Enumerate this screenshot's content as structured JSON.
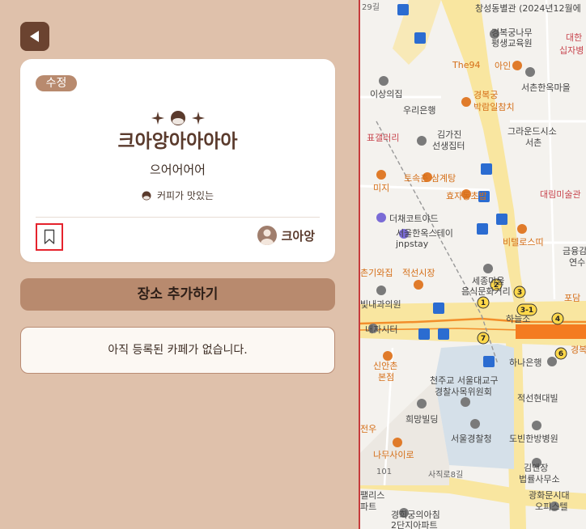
{
  "cafe": {
    "edit_label": "수정",
    "title": "크아앙아아아아",
    "subtitle": "으어어어어",
    "tag": "커피가 맛있는",
    "author": "크아앙"
  },
  "actions": {
    "add_place_label": "장소 추가하기"
  },
  "list": {
    "empty_message": "아직 등록된 카페가 없습니다."
  },
  "map": {
    "labels": {
      "changseong": "창성동별관 (2024년12월에",
      "gyeongbokgung_tree": "경복궁나무",
      "kindergarten": "평생교육원",
      "daehan": "대한",
      "red_cross": "십자병",
      "the94": "The94",
      "ain": "아인",
      "seochon": "서촌한옥마을",
      "isangui": "이상의집",
      "woori": "우리은행",
      "museum1": "경복궁",
      "museum2": "박람일참치",
      "gallery": "표갤러리",
      "gimgajin1": "김가진",
      "gimgajin2": "선생집터",
      "ground1": "그라운드시소",
      "ground2": "서촌",
      "mj": "미지",
      "tosokchon": "토속촌 삼계탕",
      "hyoja": "효자동초밥",
      "daelim": "대림미술관",
      "thechaek": "더채코트야드",
      "hanok1": "서울한옥스테이",
      "hanok2": "jnpstay",
      "bitel": "비텔로스띠",
      "geumyung": "금융감",
      "yeonsu": "연수",
      "chungi": "촌기와집",
      "jeokseon": "적선시장",
      "sejong1": "세종마을",
      "sejong2": "음식문화거리",
      "pojang": "포담",
      "bitnae": "빛내과의원",
      "naeja": "내자시터",
      "haneul": "하늘소",
      "hana": "하나은행",
      "gyeongbok_sub": "경복",
      "sinanchon1": "신안촌",
      "sinanchon2": "본점",
      "cheonju1": "천주교 서울대교구",
      "cheonju2": "경찰사목위원회",
      "seoseon": "적선현대빌",
      "huimang": "희망빌딩",
      "police": "서울경찰청",
      "dobin": "도빈한방병원",
      "nine": "나무사이로",
      "jeonwu": "전우",
      "kimjang1": "김앤장",
      "kimjang2": "법률사무소",
      "sajik": "사직로8길",
      "road101": "101",
      "palace1": "팰리스",
      "palace2": "파트",
      "gwanghwa1": "광화문시대",
      "gwanghwa2": "오피스텔",
      "gyeonghui1": "경희궁의아침",
      "gyeonghui2": "2단지아파트",
      "top_road": "29길",
      "bus_n1": "1",
      "bus_n2": "2",
      "bus_n3": "3",
      "bus_n31": "3-1",
      "bus_n4": "4",
      "bus_n6": "6",
      "bus_n7": "7"
    }
  },
  "colors": {
    "background": "#dfc1ab",
    "accent": "#b88a6e",
    "dark": "#6b4330",
    "highlight": "#e5232d"
  }
}
